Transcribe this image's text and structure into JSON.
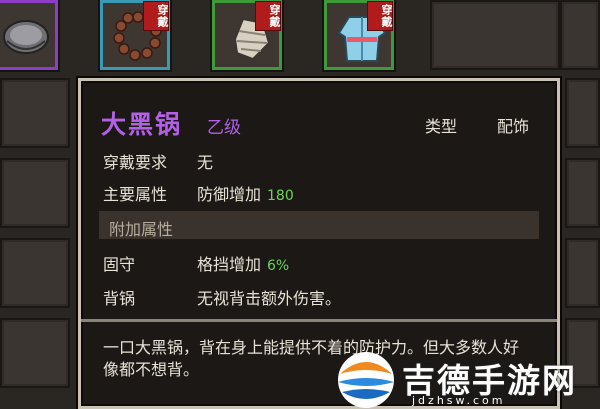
{
  "equipment_slots": [
    {
      "icon": "wok-icon",
      "worn": false,
      "border": "purple"
    },
    {
      "icon": "prayer-beads-icon",
      "worn": true,
      "worn_label": "穿戴",
      "border": "teal"
    },
    {
      "icon": "bandaged-hand-icon",
      "worn": true,
      "worn_label": "穿戴",
      "border": "green"
    },
    {
      "icon": "robe-icon",
      "worn": true,
      "worn_label": "穿戴",
      "border": "green"
    }
  ],
  "tooltip": {
    "name": "大黑锅",
    "grade": "乙级",
    "type_label": "类型",
    "type_value": "配饰",
    "requirement_label": "穿戴要求",
    "requirement_value": "无",
    "main_attr_label": "主要属性",
    "main_attr_value": "防御增加",
    "main_attr_num": "180",
    "extra_section": "附加属性",
    "extra_1_label": "固守",
    "extra_1_value": "格挡增加",
    "extra_1_num": "6%",
    "extra_2_label": "背锅",
    "extra_2_value": "无视背击额外伤害。",
    "description": "一口大黑锅，背在身上能提供不着的防护力。但大多数人好像都不想背。"
  },
  "watermark": {
    "text": "吉德手游网",
    "sub": "jdzhsw.com"
  },
  "colors": {
    "rare_purple": "#b35fe6",
    "value_green": "#6cd45a",
    "worn_red": "#b01c1c"
  }
}
